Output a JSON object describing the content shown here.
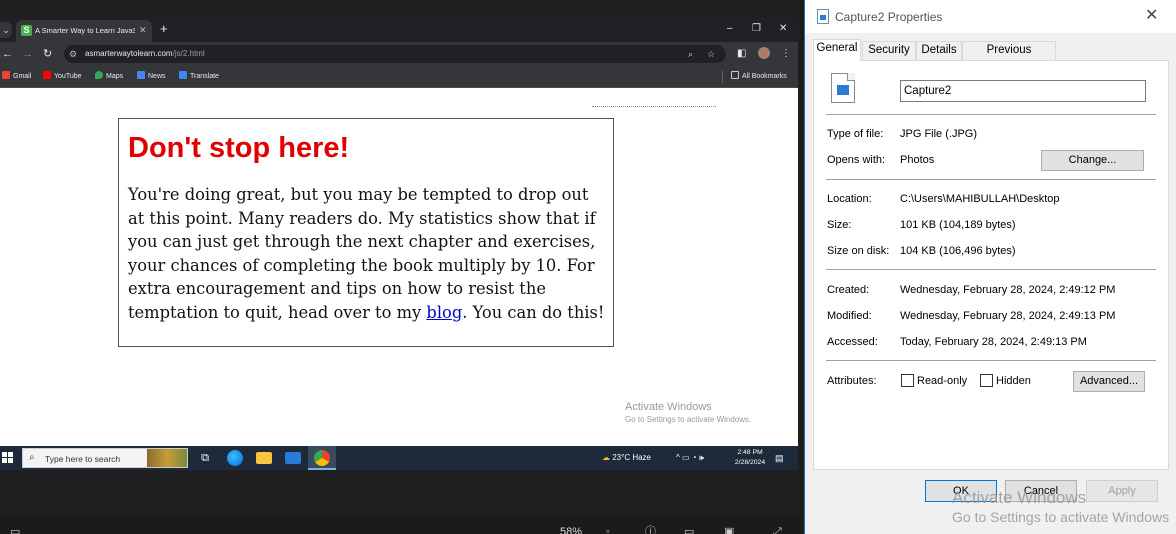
{
  "browser": {
    "tab": {
      "favicon_letter": "S",
      "title": "A Smarter Way to Learn JavaScr",
      "close": "✕",
      "new_tab": "+"
    },
    "url": {
      "host": "asmarterwaytolearn.com",
      "path": "/js/2.html"
    },
    "bookmarks": [
      {
        "label": "Gmail",
        "color": "#ea4335"
      },
      {
        "label": "YouTube",
        "color": "#ff0000"
      },
      {
        "label": "Maps",
        "color": "#34a853"
      },
      {
        "label": "News",
        "color": "#4285f4"
      },
      {
        "label": "Translate",
        "color": "#4285f4"
      }
    ],
    "all_bookmarks": "All Bookmarks"
  },
  "page": {
    "heading": "Don't stop here!",
    "body_before_link": "You're doing great, but you may be tempted to drop out at this point. Many readers do. My statistics show that if you can just get through the next chapter and exercises, your chances of completing the book multiply by 10. For extra encouragement and tips on how to resist the temptation to quit, head over to my ",
    "link_text": "blog",
    "body_after_link": ". You can do this!",
    "activate_title": "Activate Windows",
    "activate_sub": "Go to Settings to activate Windows."
  },
  "taskbar": {
    "search_placeholder": "Type here to search",
    "weather": "23°C  Haze",
    "time": "2:48 PM",
    "date": "2/28/2024"
  },
  "viewer": {
    "zoom": "58%"
  },
  "dialog": {
    "title": "Capture2 Properties",
    "tabs": [
      "General",
      "Security",
      "Details",
      "Previous Versions"
    ],
    "file_name": "Capture2",
    "type_label": "Type of file:",
    "type_value": "JPG File (.JPG)",
    "opens_label": "Opens with:",
    "opens_value": "Photos",
    "change_button": "Change...",
    "location_label": "Location:",
    "location_value": "C:\\Users\\MAHIBULLAH\\Desktop",
    "size_label": "Size:",
    "size_value": "101 KB (104,189 bytes)",
    "size_on_disk_label": "Size on disk:",
    "size_on_disk_value": "104 KB (106,496 bytes)",
    "created_label": "Created:",
    "created_value": "Wednesday, February 28, 2024, 2:49:12 PM",
    "modified_label": "Modified:",
    "modified_value": "Wednesday, February 28, 2024, 2:49:13 PM",
    "accessed_label": "Accessed:",
    "accessed_value": "Today, February 28, 2024, 2:49:13 PM",
    "attributes_label": "Attributes:",
    "readonly_label": "Read-only",
    "hidden_label": "Hidden",
    "advanced_button": "Advanced...",
    "ok_button": "OK",
    "cancel_button": "Cancel",
    "apply_button": "Apply",
    "activate_title": "Activate Windows",
    "activate_sub": "Go to Settings to activate Windows"
  }
}
